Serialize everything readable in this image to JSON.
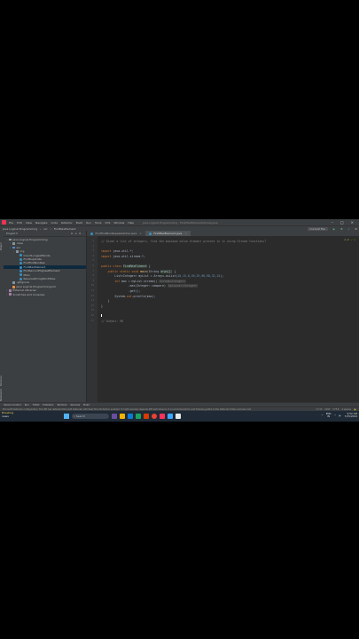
{
  "menubar": {
    "items": [
      "File",
      "Edit",
      "View",
      "Navigate",
      "Code",
      "Refactor",
      "Build",
      "Run",
      "Tools",
      "VCS",
      "Window",
      "Help"
    ],
    "window_title": "Java Logical Programming - FindMaxElementInArray.java"
  },
  "navbar": {
    "breadcrumbs": [
      "Java Logical Programming",
      "src",
      "FindMaxElement"
    ],
    "run_config": "Current File"
  },
  "project_panel": {
    "title": "Project",
    "tree": [
      {
        "label": "Java Logical Programming",
        "kind": "folder",
        "depth": 0
      },
      {
        "label": ".idea",
        "kind": "folder",
        "depth": 1
      },
      {
        "label": "src",
        "kind": "src",
        "depth": 1
      },
      {
        "label": "org",
        "kind": "folder",
        "depth": 2
      },
      {
        "label": "CountLongestWords",
        "kind": "class",
        "depth": 3
      },
      {
        "label": "FindDuplicate",
        "kind": "class",
        "depth": 3
      },
      {
        "label": "FindFirstNonRep",
        "kind": "class",
        "depth": 3
      },
      {
        "label": "FindMaxElement",
        "kind": "class",
        "depth": 3,
        "selected": true
      },
      {
        "label": "FindSecondHighestElement",
        "kind": "class",
        "depth": 3
      },
      {
        "label": "Main",
        "kind": "class",
        "depth": 3
      },
      {
        "label": "ReverseStringWordWise",
        "kind": "class",
        "depth": 3
      },
      {
        "label": ".gitignore",
        "kind": "file",
        "depth": 1
      },
      {
        "label": "Java Logical Programming.iml",
        "kind": "xml",
        "depth": 1
      },
      {
        "label": "External Libraries",
        "kind": "lib",
        "depth": 0
      },
      {
        "label": "Scratches and Consoles",
        "kind": "lib",
        "depth": 0
      }
    ]
  },
  "tabs": [
    {
      "label": "FindFirstNonRepeatedChar.java",
      "active": false
    },
    {
      "label": "FindMaxElement.java",
      "active": true
    }
  ],
  "editor": {
    "lines": [
      {
        "n": "1",
        "parts": [
          {
            "t": "// Given a list of integers, find the maximum value element present in it using Stream functions?",
            "c": "cmt"
          }
        ]
      },
      {
        "n": "2",
        "parts": []
      },
      {
        "n": "3",
        "parts": [
          {
            "t": "import ",
            "c": "kw"
          },
          {
            "t": "java.util.*;",
            "c": ""
          }
        ]
      },
      {
        "n": "4",
        "parts": [
          {
            "t": "import ",
            "c": "kw"
          },
          {
            "t": "java.util.stream.*;",
            "c": ""
          }
        ]
      },
      {
        "n": "5",
        "parts": []
      },
      {
        "n": "6",
        "parts": [
          {
            "t": "public class ",
            "c": "kw"
          },
          {
            "t": "FindMaxElement",
            "c": "hl"
          },
          {
            "t": " {",
            "c": ""
          }
        ]
      },
      {
        "n": "7",
        "parts": [
          {
            "t": "    public static void ",
            "c": "kw"
          },
          {
            "t": "main",
            "c": "fn"
          },
          {
            "t": "(String ",
            "c": ""
          },
          {
            "t": "args[]",
            "c": "hl"
          },
          {
            "t": ") {",
            "c": ""
          }
        ]
      },
      {
        "n": "8",
        "parts": [
          {
            "t": "        List<Integer> myList = Arrays.",
            "c": ""
          },
          {
            "t": "asList",
            "c": "mth"
          },
          {
            "t": "(",
            "c": ""
          },
          {
            "t": "10,15,8,49,25,98,98,32,15",
            "c": "num"
          },
          {
            "t": ");",
            "c": ""
          }
        ]
      },
      {
        "n": "9",
        "parts": [
          {
            "t": "        int ",
            "c": "kw"
          },
          {
            "t": "max = myList.stream() ",
            "c": ""
          },
          {
            "t": "Stream<Integer>",
            "c": "hint"
          }
        ]
      },
      {
        "n": "10",
        "parts": [
          {
            "t": "                .max(Integer::compare) ",
            "c": ""
          },
          {
            "t": "Optional<Integer>",
            "c": "hint"
          }
        ]
      },
      {
        "n": "11",
        "parts": [
          {
            "t": "                .get();",
            "c": ""
          }
        ]
      },
      {
        "n": "12",
        "parts": [
          {
            "t": "        System.",
            "c": ""
          },
          {
            "t": "out",
            "c": "kw"
          },
          {
            "t": ".println(max);",
            "c": ""
          }
        ]
      },
      {
        "n": "13",
        "parts": [
          {
            "t": "    }",
            "c": ""
          }
        ]
      },
      {
        "n": "14",
        "parts": [
          {
            "t": "}",
            "c": ""
          }
        ]
      },
      {
        "n": "15",
        "parts": []
      },
      {
        "n": "16",
        "parts": []
      },
      {
        "n": "17",
        "parts": [
          {
            "t": "// Output: 98",
            "c": "cmt"
          }
        ]
      }
    ],
    "warnings": "⚠ 2",
    "checks": "✓ 1"
  },
  "bottom_tools": [
    "Version Control",
    "Run",
    "TODO",
    "Problems",
    "Terminal",
    "Services",
    "Build"
  ],
  "status": {
    "message": "Microsoft Defender configuration: The IDE has detected Microsoft Defender with Real-Time Protection enabled. It might severely degrade IDE performance. It is recommended to add following paths to the Defender folder exclusion list",
    "position": "17:13",
    "line_sep": "CRLF",
    "encoding": "UTF-8",
    "indent": "4 spaces"
  },
  "taskbar": {
    "weather_title": "Breaking",
    "weather_sub": "news",
    "search": "Search",
    "lang": "ENG",
    "region": "IN",
    "time": "9:52 AM",
    "date": "7/25/2024"
  },
  "colors": {
    "accent": "#4a88c7",
    "editor_bg": "#2b2b2b",
    "panel_bg": "#3c3f41"
  }
}
